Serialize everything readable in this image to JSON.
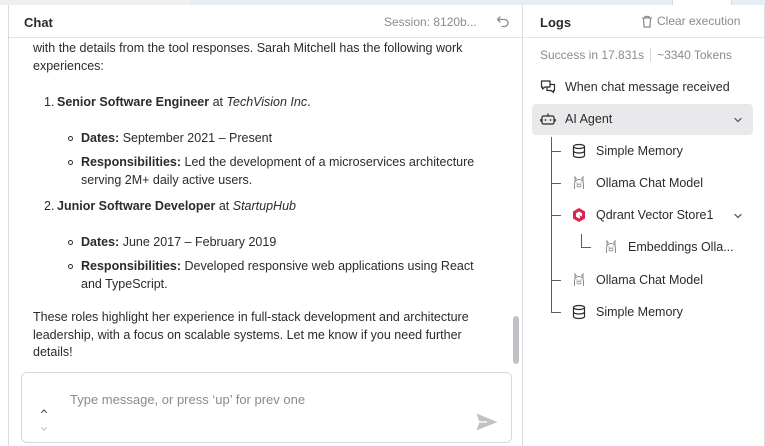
{
  "chat": {
    "title": "Chat",
    "session": "Session: 8120b...",
    "message": {
      "intro": "with the details from the tool responses. Sarah Mitchell has the following work experiences:",
      "jobs": [
        {
          "num": "1.",
          "title": "Senior Software Engineer",
          "at": " at ",
          "company": "TechVision Inc",
          "suffix": ".",
          "dates_label": "Dates:",
          "dates": " September 2021 – Present",
          "resp_label": "Responsibilities:",
          "resp": " Led the development of a microservices architecture serving 2M+ daily active users."
        },
        {
          "num": "2.",
          "title": "Junior Software Developer",
          "at": " at ",
          "company": "StartupHub",
          "suffix": "",
          "dates_label": "Dates:",
          "dates": " June 2017 – February 2019",
          "resp_label": "Responsibilities:",
          "resp": " Developed responsive web applications using React and TypeScript."
        }
      ],
      "outro": "These roles highlight her experience in full-stack development and architecture leadership, with a focus on scalable systems. Let me know if you need further details!"
    },
    "input_placeholder": "Type message, or press ‘up’ for prev one"
  },
  "logs": {
    "title": "Logs",
    "clear_label": "Clear execution",
    "success": "Success in 17.831s",
    "tokens": "~3340 Tokens",
    "nodes": {
      "trigger": "When chat message received",
      "agent": "AI Agent",
      "memory1": "Simple Memory",
      "model1": "Ollama Chat Model",
      "vector": "Qdrant Vector Store1",
      "embeddings": "Embeddings Olla...",
      "model2": "Ollama Chat Model",
      "memory2": "Simple Memory"
    }
  },
  "colors": {
    "text": "#2b2b2b",
    "muted": "#8a8a90",
    "qdrant": "#dc244c",
    "selected_bg": "#e9e9ec"
  },
  "icons": {
    "reset": "undo-icon",
    "clear": "trash-icon",
    "trigger": "chat-bubbles-icon",
    "agent": "robot-icon",
    "memory": "database-icon",
    "model": "ollama-llama-icon",
    "vector": "qdrant-icon",
    "send": "send-icon"
  }
}
